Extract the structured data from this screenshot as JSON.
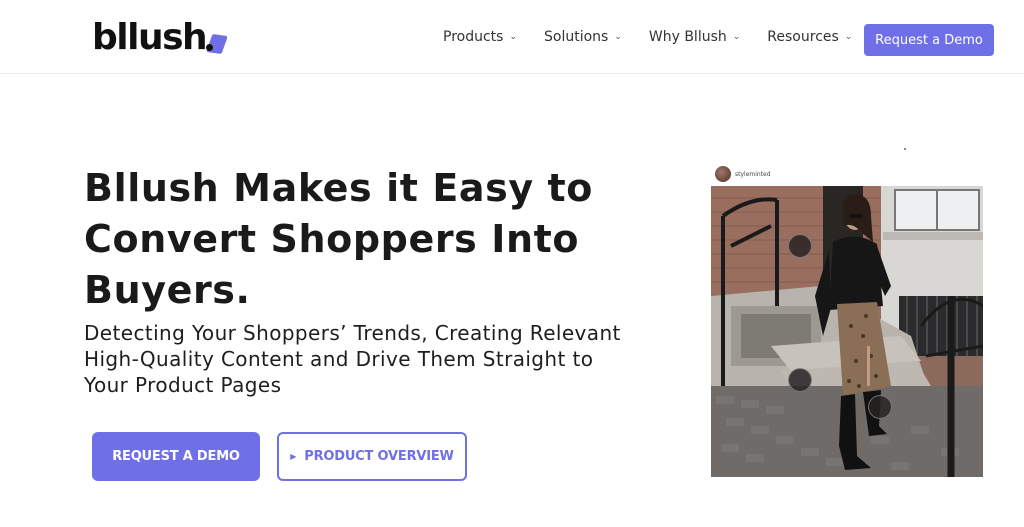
{
  "brand": {
    "name": "bllush",
    "accent": "#6f6fe8"
  },
  "nav": {
    "items": [
      {
        "label": "Products"
      },
      {
        "label": "Solutions"
      },
      {
        "label": "Why Bllush"
      },
      {
        "label": "Resources"
      }
    ],
    "cta_label": "Request a Demo"
  },
  "hero": {
    "title": "Bllush Makes it Easy to Convert Shoppers Into Buyers.",
    "subtitle": "Detecting Your Shoppers’ Trends, Creating Relevant High-Quality Content and Drive Them Straight to Your Product Pages",
    "primary_cta": "REQUEST A DEMO",
    "secondary_cta": "PRODUCT OVERVIEW"
  },
  "post": {
    "username": "styleminted"
  }
}
